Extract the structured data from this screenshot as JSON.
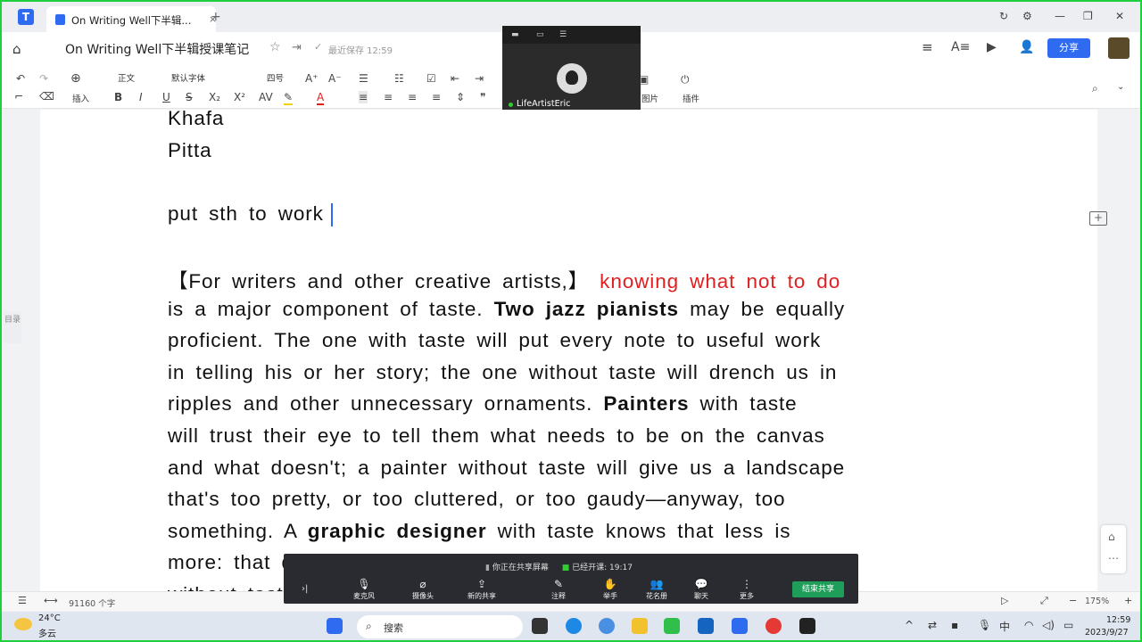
{
  "tabbar": {
    "tab_title": "On Writing Well下半辑...",
    "add_tab": "+",
    "close_tab": "×"
  },
  "titlebar": {
    "doc_title": "On Writing Well下半辑授课笔记",
    "save_status": "最近保存 12:59",
    "share_label": "分享"
  },
  "toolbar": {
    "insert_label": "插入",
    "style_value": "正文",
    "font_value": "默认字体",
    "size_value": "四号",
    "image_label": "图片",
    "plugin_label": "插件"
  },
  "video": {
    "name": "LifeArtistEric"
  },
  "document": {
    "line1": "Khafa",
    "line2": "Pitta",
    "line3": "put sth to work",
    "p1_a": "【For writers and other creative artists,】 ",
    "p1_red": "knowing what not to do",
    "p2_a": "is a major component of taste. ",
    "p2_b": "Two jazz pianists",
    "p2_c": " may be equally",
    "p3": "proficient. The one with taste will put every note to useful work",
    "p4": "in telling his or her story; the one without taste will drench us in",
    "p5_a": "ripples and other unnecessary ornaments. ",
    "p5_b": "Painters",
    "p5_c": " with taste",
    "p6": "will trust their eye to tell them what needs to be on the canvas",
    "p7": "and what doesn't; a painter without taste will give us a landscape",
    "p8": "that's too pretty, or too cluttered, or too gaudy—anyway, too",
    "p9_a": "something. A ",
    "p9_b": "graphic designer",
    "p9_c": " with taste knows that less is",
    "p10": "more: that design is the servant of the written word. A designer",
    "p11": "without taste will clutter the page with visual noise and"
  },
  "toc_label": "目录",
  "meeting": {
    "status": "你正在共享屏幕",
    "elapsed": "已经开课: 19:17",
    "buttons": [
      {
        "icon": "mic-icon",
        "label": "麦克风"
      },
      {
        "icon": "camera-icon",
        "label": "摄像头"
      },
      {
        "icon": "share-icon",
        "label": "新的共享"
      },
      {
        "icon": "annotate-icon",
        "label": "注释"
      },
      {
        "icon": "hand-icon",
        "label": "举手"
      },
      {
        "icon": "roster-icon",
        "label": "花名册"
      },
      {
        "icon": "chat-icon",
        "label": "聊天"
      },
      {
        "icon": "more-icon",
        "label": "更多"
      }
    ],
    "end_share": "结束共享"
  },
  "statusbar": {
    "word_count": "91160 个字",
    "zoom": "175%"
  },
  "taskbar": {
    "temperature": "24°C",
    "weather": "多云",
    "search_placeholder": "搜索",
    "ime": "中",
    "time": "12:59",
    "date": "2023/9/27"
  },
  "colors": {
    "accent": "#2f6bf0",
    "highlight_red": "#e02020",
    "border_green": "#1fcf3f",
    "end_share_green": "#1f9e5a"
  }
}
